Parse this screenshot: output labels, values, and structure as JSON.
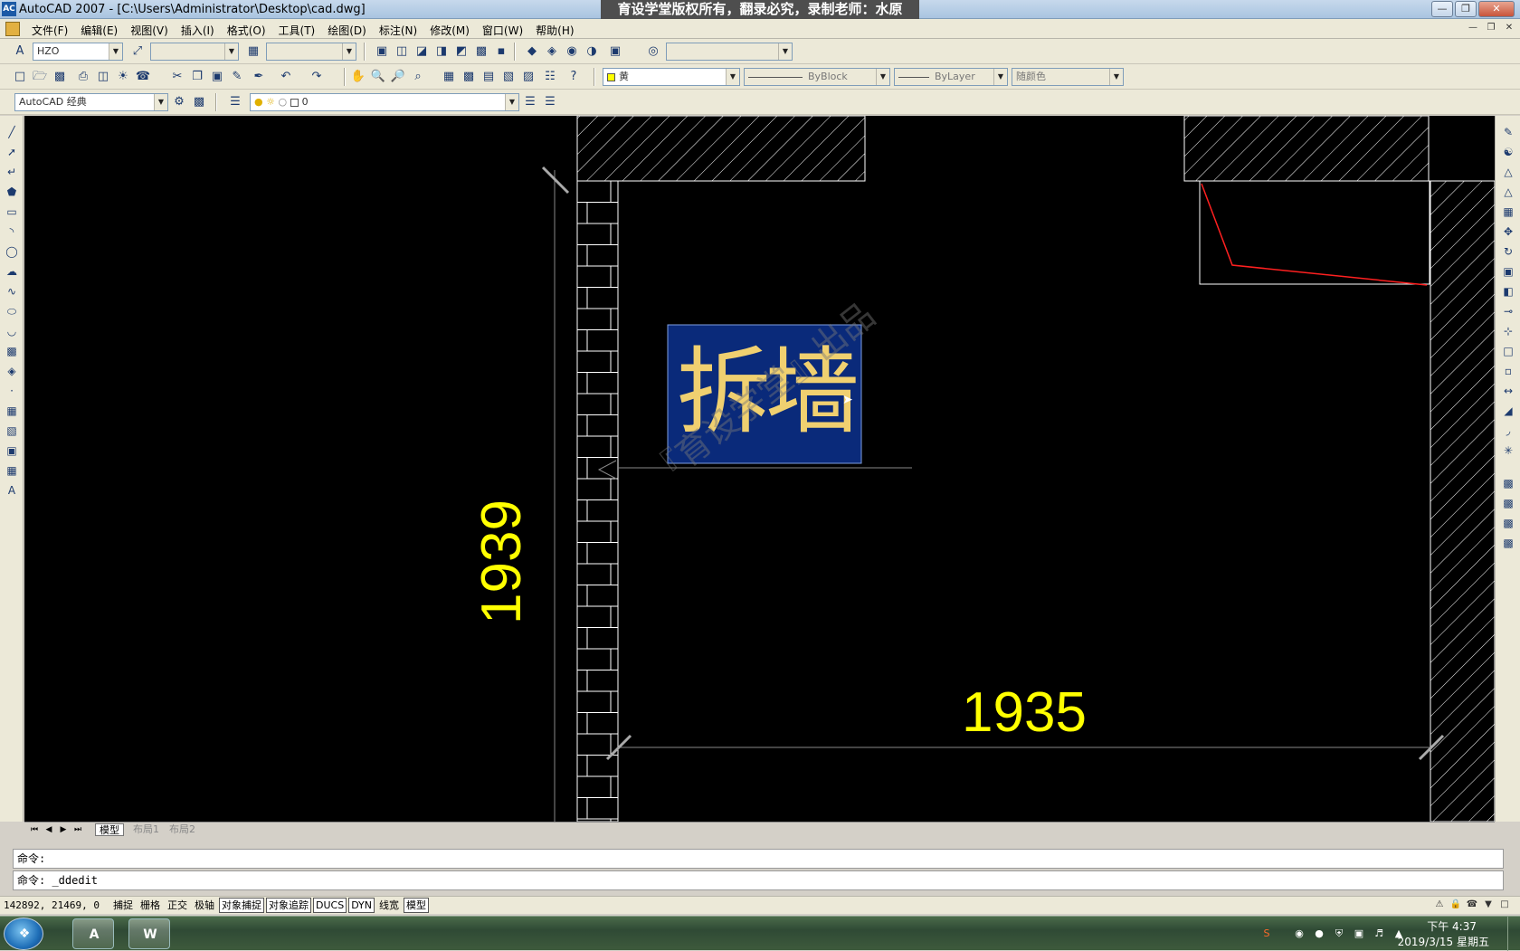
{
  "window": {
    "title": "AutoCAD 2007 - [C:\\Users\\Administrator\\Desktop\\cad.dwg]",
    "banner": "育设学堂版权所有，翻录必究，录制老师：水原",
    "logo_text": "AC"
  },
  "menu": [
    "文件(F)",
    "编辑(E)",
    "视图(V)",
    "插入(I)",
    "格式(O)",
    "工具(T)",
    "绘图(D)",
    "标注(N)",
    "修改(M)",
    "窗口(W)",
    "帮助(H)"
  ],
  "toolbar": {
    "text_style": "HZO",
    "workspace": "AutoCAD 经典",
    "layer": "0",
    "color": "黄",
    "color_hex": "#ffff00",
    "linetype": "ByBlock",
    "lineweight": "ByLayer",
    "plotstyle": "随颜色"
  },
  "drawing": {
    "selected_text": "拆墙",
    "dim_vertical": "1939",
    "dim_horizontal": "1935",
    "watermark": "『育设学堂』出品",
    "colors": {
      "background": "#000000",
      "dimension": "#ffff00",
      "text_highlight": "#0a2a7a",
      "text": "#f0d070",
      "line": "#ffffff",
      "red_line": "#ff2020"
    }
  },
  "layout_tabs": {
    "model": "模型",
    "layout1": "布局1",
    "layout2": "布局2"
  },
  "command": {
    "line1": "命令:",
    "line2": "命令: _ddedit"
  },
  "status": {
    "coords": "142892, 21469, 0",
    "buttons": [
      "捕捉",
      "栅格",
      "正交",
      "极轴",
      "对象捕捉",
      "对象追踪",
      "DUCS",
      "DYN",
      "线宽",
      "模型"
    ]
  },
  "taskbar": {
    "time": "下午 4:37",
    "date": "2019/3/15 星期五"
  }
}
